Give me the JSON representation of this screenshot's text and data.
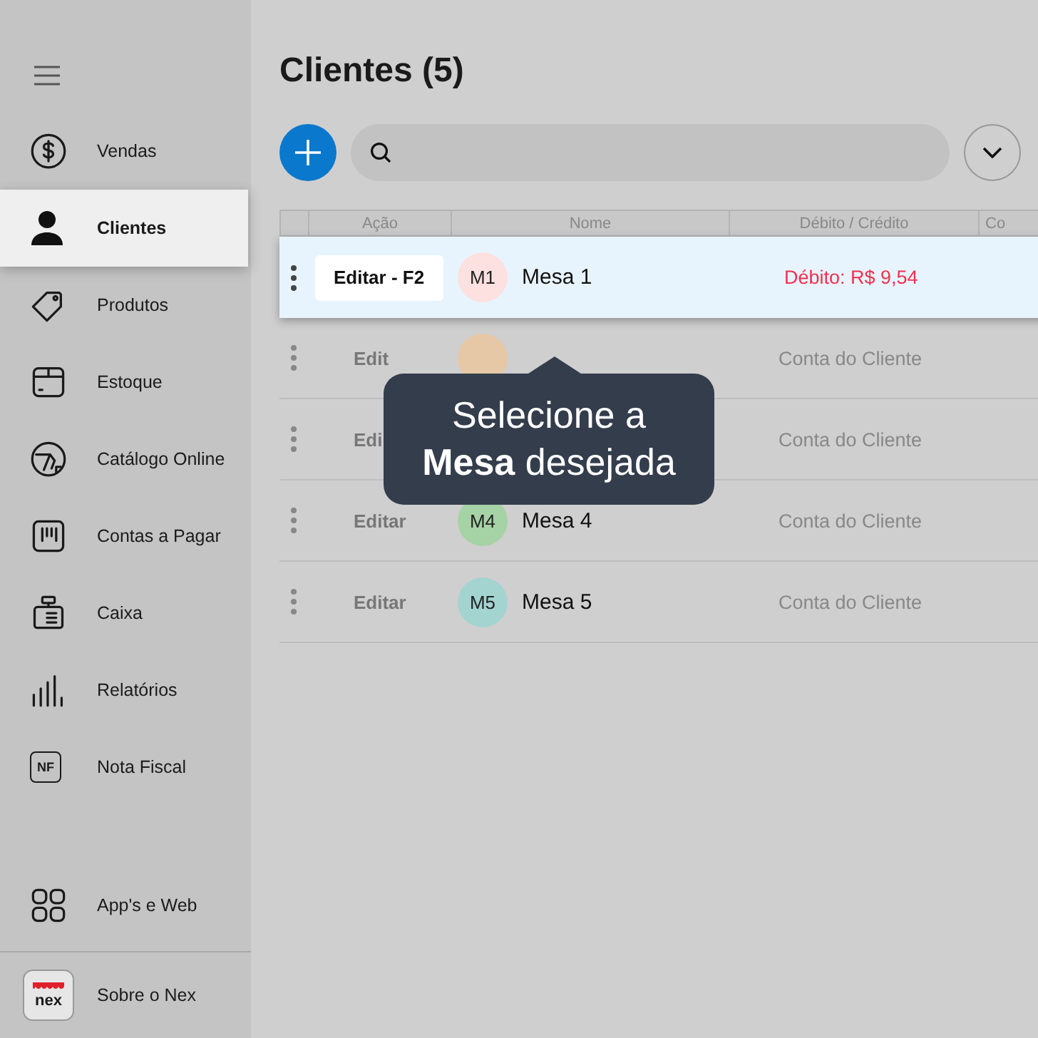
{
  "sidebar": {
    "items": [
      {
        "label": "Vendas",
        "kind": "dollar",
        "selected": false
      },
      {
        "label": "Clientes",
        "kind": "person",
        "selected": true
      },
      {
        "label": "Produtos",
        "kind": "tag",
        "selected": false
      },
      {
        "label": "Estoque",
        "kind": "box",
        "selected": false
      },
      {
        "label": "Catálogo Online",
        "kind": "catalog",
        "selected": false
      },
      {
        "label": "Contas a Pagar",
        "kind": "bill",
        "selected": false
      },
      {
        "label": "Caixa",
        "kind": "register",
        "selected": false
      },
      {
        "label": "Relatórios",
        "kind": "bars",
        "selected": false
      },
      {
        "label": "Nota Fiscal",
        "kind": "nf",
        "selected": false,
        "icon_text": "NF"
      }
    ],
    "footer_items": [
      {
        "label": "App's e Web",
        "kind": "grid"
      },
      {
        "label": "Sobre o Nex",
        "kind": "logo",
        "icon_text": "nex"
      }
    ]
  },
  "page_title": "Clientes (5)",
  "table": {
    "columns": [
      "",
      "Ação",
      "Nome",
      "Débito / Crédito",
      "Co"
    ],
    "rows": [
      {
        "selected": true,
        "action": "Editar - F2",
        "avatar": {
          "label": "M1",
          "color": "#fde0e0"
        },
        "name": "Mesa 1",
        "balance": "Débito: R$ 9,54",
        "kind": "debit"
      },
      {
        "selected": false,
        "action": "Edit",
        "avatar": {
          "color": "#e6c8a6"
        },
        "balance": "Conta do Cliente",
        "kind": "account"
      },
      {
        "selected": false,
        "action": "Edi",
        "balance": "Conta do Cliente",
        "kind": "account"
      },
      {
        "selected": false,
        "action": "Editar",
        "avatar": {
          "label": "M4",
          "color": "#a6d3a6"
        },
        "name": "Mesa 4",
        "balance": "Conta do Cliente",
        "kind": "account"
      },
      {
        "selected": false,
        "action": "Editar",
        "avatar": {
          "label": "M5",
          "color": "#a3d4d0"
        },
        "name": "Mesa 5",
        "balance": "Conta do Cliente",
        "kind": "account"
      }
    ]
  },
  "tooltip": "Selecione a **Mesa** desejada"
}
